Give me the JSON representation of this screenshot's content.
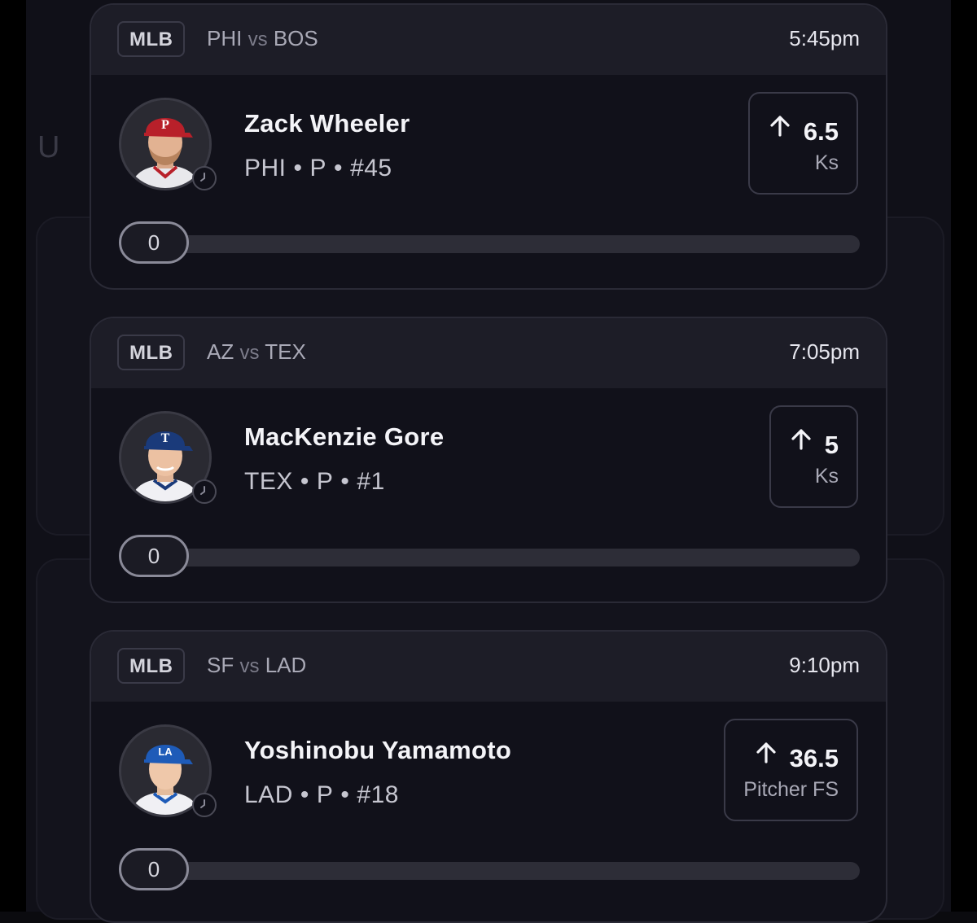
{
  "cards": [
    {
      "league": "MLB",
      "home": "PHI",
      "vs": "vs",
      "away": "BOS",
      "time": "5:45pm",
      "player": {
        "name": "Zack Wheeler",
        "team": "PHI",
        "position": "P",
        "number": "#45",
        "cap_color": "#b8202a",
        "cap_logo": "P"
      },
      "line": "6.5",
      "stat": "Ks",
      "direction": "up-arrow-icon",
      "progress_value": "0",
      "progress_fraction": 0
    },
    {
      "league": "MLB",
      "home": "AZ",
      "vs": "vs",
      "away": "TEX",
      "time": "7:05pm",
      "player": {
        "name": "MacKenzie Gore",
        "team": "TEX",
        "position": "P",
        "number": "#1",
        "cap_color": "#1a3a7a",
        "cap_logo": "T"
      },
      "line": "5",
      "stat": "Ks",
      "direction": "up-arrow-icon",
      "progress_value": "0",
      "progress_fraction": 0
    },
    {
      "league": "MLB",
      "home": "SF",
      "vs": "vs",
      "away": "LAD",
      "time": "9:10pm",
      "player": {
        "name": "Yoshinobu Yamamoto",
        "team": "LAD",
        "position": "P",
        "number": "#18",
        "cap_color": "#1e5bb8",
        "cap_logo": "LA"
      },
      "line": "36.5",
      "stat": "Pitcher FS",
      "direction": "up-arrow-icon",
      "progress_value": "0",
      "progress_fraction": 0
    }
  ],
  "separator": "•",
  "colors": {
    "card_bg": "#11111a",
    "header_bg": "#1d1d27",
    "border": "#2a2a36",
    "track": "#2d2d37"
  }
}
